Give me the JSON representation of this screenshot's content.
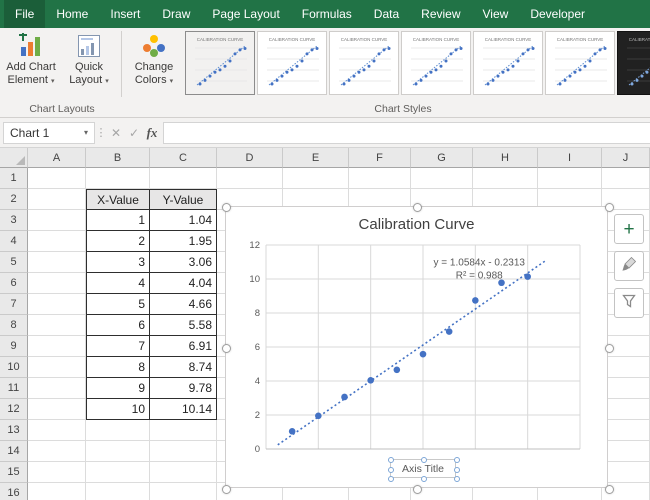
{
  "icons": {
    "caret_down": "▾"
  },
  "ribbon_tabs": [
    {
      "label": "File",
      "active": true
    },
    {
      "label": "Home"
    },
    {
      "label": "Insert"
    },
    {
      "label": "Draw"
    },
    {
      "label": "Page Layout"
    },
    {
      "label": "Formulas"
    },
    {
      "label": "Data"
    },
    {
      "label": "Review"
    },
    {
      "label": "View"
    },
    {
      "label": "Developer"
    }
  ],
  "ribbon": {
    "add_chart_element_label": "Add Chart Element",
    "quick_layout_label": "Quick Layout",
    "change_colors_label": "Change Colors",
    "chart_layouts_group_label": "Chart Layouts",
    "chart_styles_group_label": "Chart Styles",
    "style_thumbnails": 6
  },
  "formula_bar": {
    "name_box": "Chart 1",
    "cancel_glyph": "✕",
    "enter_glyph": "✓",
    "fx_glyph": "fx",
    "formula_value": ""
  },
  "grid": {
    "col_headers": [
      "A",
      "B",
      "C",
      "D",
      "E",
      "F",
      "G",
      "H",
      "I",
      "J"
    ],
    "row_count": 16,
    "table": {
      "headers": [
        "X-Value",
        "Y-Value"
      ],
      "x": [
        "1",
        "2",
        "3",
        "4",
        "5",
        "6",
        "7",
        "8",
        "9",
        "10"
      ],
      "y": [
        "1.04",
        "1.95",
        "3.06",
        "4.04",
        "4.66",
        "5.58",
        "6.91",
        "8.74",
        "9.78",
        "10.14"
      ]
    }
  },
  "chart": {
    "axis_title": "Axis Title"
  },
  "chart_data": {
    "type": "scatter",
    "title": "Calibration Curve",
    "x": [
      1,
      2,
      3,
      4,
      5,
      6,
      7,
      8,
      9,
      10
    ],
    "y": [
      1.04,
      1.95,
      3.06,
      4.04,
      4.66,
      5.58,
      6.91,
      8.74,
      9.78,
      10.14
    ],
    "xlim": [
      0,
      12
    ],
    "ylim": [
      0,
      12
    ],
    "xticks": [
      0,
      2,
      4,
      6,
      8,
      10,
      12
    ],
    "yticks": [
      0,
      2,
      4,
      6,
      8,
      10,
      12
    ],
    "grid": true,
    "legend": "none",
    "point_color": "#4472c4",
    "trendline": {
      "slope": 1.0584,
      "intercept": -0.2313,
      "style": "dotted",
      "equation_label": "y = 1.0584x - 0.2313",
      "r2_label": "R² = 0.988"
    }
  },
  "side_tools": {
    "elements_glyph": "+"
  },
  "colors": {
    "excel_green": "#217346",
    "accent_blue": "#4472c4"
  }
}
